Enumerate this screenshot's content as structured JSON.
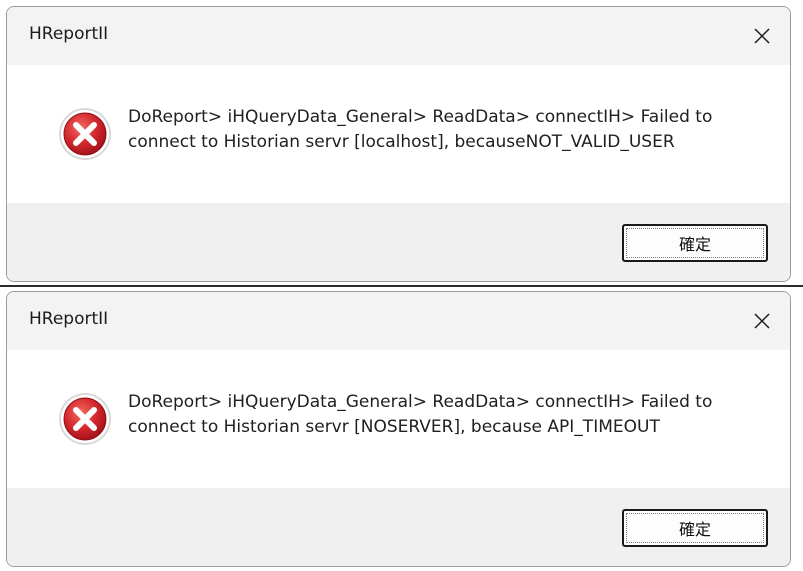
{
  "dialogs": [
    {
      "title": "HReportII",
      "message": "DoReport> iHQueryData_General> ReadData> connectIH> Failed to connect to Historian servr [localhost], becauseNOT_VALID_USER",
      "ok_label": "確定",
      "icon": "error-icon",
      "close_icon": "close-icon"
    },
    {
      "title": "HReportII",
      "message": "DoReport> iHQueryData_General> ReadData> connectIH> Failed to connect to Historian servr [NOSERVER], because API_TIMEOUT",
      "ok_label": "確定",
      "icon": "error-icon",
      "close_icon": "close-icon"
    }
  ],
  "colors": {
    "error_red": "#c8202a",
    "titlebar": "#f3f3f3",
    "footer": "#f0f0f0"
  }
}
